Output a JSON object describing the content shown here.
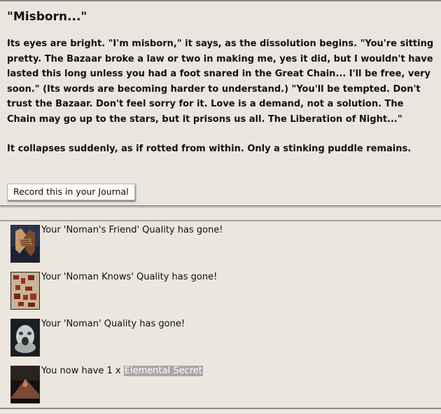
{
  "story": {
    "title": "\"Misborn...\"",
    "paragraph1": "Its eyes are bright. \"I'm misborn,\" it says, as the dissolution begins. \"You're sitting pretty. The Bazaar broke a law or two in making me, yes it did, but I wouldn't have lasted this long unless you had a foot snared in the Great Chain... I'll be free, very soon.\" (Its words are becoming harder to understand.) \"You'll be tempted. Don't trust the Bazaar. Don't feel sorry for it. Love is a demand, not a solution. The Chain may go up to the stars, but it prisons us all. The Liberation of Night...\"",
    "paragraph2": "It collapses suddenly, as if rotted from within. Only a stinking puddle remains.",
    "journal_button": "Record this in your Journal"
  },
  "results": [
    {
      "icon": "clasped-hands-icon",
      "text": "Your 'Noman's Friend' Quality has gone!"
    },
    {
      "icon": "puzzle-pieces-icon",
      "text": "Your 'Noman Knows' Quality has gone!"
    },
    {
      "icon": "screaming-face-icon",
      "text": "Your 'Noman' Quality has gone!"
    },
    {
      "icon": "mountain-icon",
      "text_prefix": "You now have 1 x ",
      "item": "Elemental Secret"
    }
  ],
  "colors": {
    "background": "#ebe6de",
    "highlight": "#a8a8a8"
  }
}
